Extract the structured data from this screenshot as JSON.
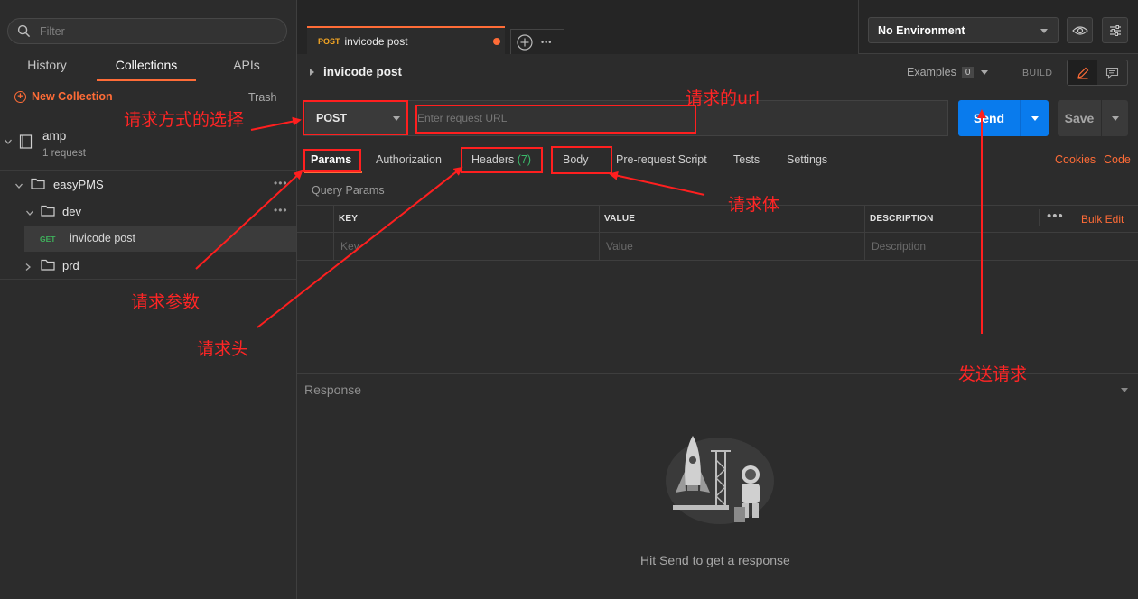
{
  "sidebar": {
    "filter_placeholder": "Filter",
    "tabs": [
      "History",
      "Collections",
      "APIs"
    ],
    "new_collection": "New Collection",
    "trash": "Trash",
    "collection": {
      "name": "amp",
      "meta": "1 request"
    },
    "folder": "easyPMS",
    "subfolder": "dev",
    "request": {
      "method": "GET",
      "name": "invicode post"
    },
    "subfolder2": "prd"
  },
  "tab": {
    "method": "POST",
    "name": "invicode post"
  },
  "env": {
    "selected": "No Environment"
  },
  "request": {
    "title": "invicode post",
    "examples_label": "Examples",
    "examples_count": "0",
    "build": "BUILD",
    "method": "POST",
    "url_placeholder": "Enter request URL",
    "send": "Send",
    "save": "Save"
  },
  "req_tabs": {
    "params": "Params",
    "authorization": "Authorization",
    "headers": "Headers",
    "headers_count": "(7)",
    "body": "Body",
    "prerequest": "Pre-request Script",
    "tests": "Tests",
    "settings": "Settings",
    "cookies": "Cookies",
    "code": "Code"
  },
  "params": {
    "title": "Query Params",
    "columns": [
      "KEY",
      "VALUE",
      "DESCRIPTION"
    ],
    "placeholders": [
      "Key",
      "Value",
      "Description"
    ],
    "bulk_edit": "Bulk Edit"
  },
  "response": {
    "label": "Response",
    "empty": "Hit Send to get a response"
  },
  "annotations": {
    "method": "请求方式的选择",
    "url": "请求的url",
    "body": "请求体",
    "params": "请求参数",
    "headers": "请求头",
    "send": "发送请求",
    "color": "#ff1f1f"
  },
  "colors": {
    "accent": "#ff6c37",
    "send": "#097bed",
    "background": "#2c2c2c"
  }
}
